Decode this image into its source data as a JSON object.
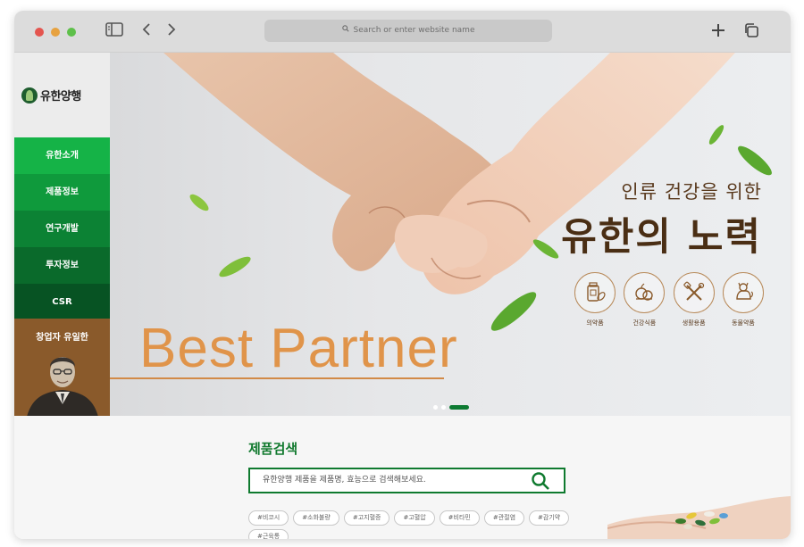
{
  "browser": {
    "address_placeholder": "Search or enter website name",
    "icons": [
      "sidebar-toggle-icon",
      "back-icon",
      "forward-icon",
      "search-icon",
      "new-tab-icon",
      "tabs-overview-icon"
    ]
  },
  "sidebar": {
    "logo_text": "유한양행",
    "nav": [
      {
        "label": "유한소개",
        "color": "#15b347"
      },
      {
        "label": "제품정보",
        "color": "#0f9a3c"
      },
      {
        "label": "연구개발",
        "color": "#0c8234"
      },
      {
        "label": "투자정보",
        "color": "#0a6a2b"
      },
      {
        "label": "CSR",
        "color": "#075323"
      }
    ],
    "founder_label": "창업자 유일한"
  },
  "hero": {
    "headline_line1": "인류 건강을 위한",
    "headline_line2": "유한의 노력",
    "tagline": "Best Partner",
    "categories": [
      {
        "label": "의약품",
        "icon": "medicine-icon"
      },
      {
        "label": "건강식품",
        "icon": "health-food-icon"
      },
      {
        "label": "생활용품",
        "icon": "household-icon"
      },
      {
        "label": "동물약품",
        "icon": "animal-medicine-icon"
      }
    ],
    "slides_total": 3,
    "active_slide": 3
  },
  "product_search": {
    "title": "제품검색",
    "placeholder": "유한양행 제품을 제품명, 효능으로 검색해보세요.",
    "tags": [
      "#비코시",
      "#소화불량",
      "#고지혈증",
      "#고혈압",
      "#비타민",
      "#관절염",
      "#감기약",
      "#근육통"
    ]
  },
  "colors": {
    "brand_green": "#0f7a2f",
    "accent_orange": "#e0944a",
    "brown": "#5a3a1e"
  }
}
